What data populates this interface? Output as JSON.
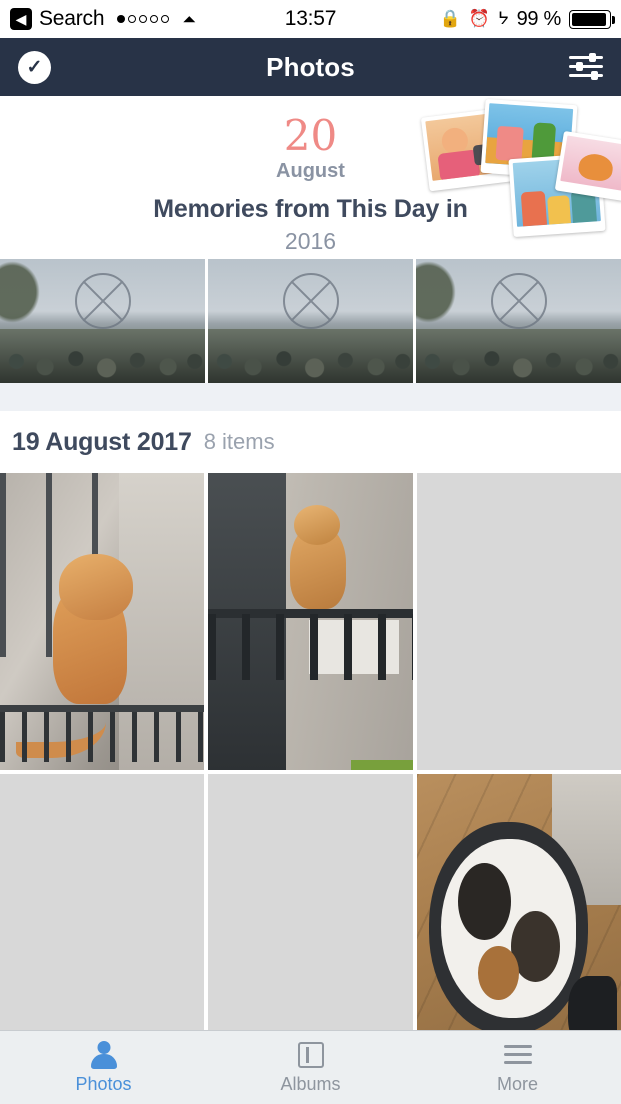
{
  "status_bar": {
    "back_label": "Search",
    "back_icon": "chevron-left-icon",
    "signal_icon": "signal-dots-icon",
    "signal_filled": 1,
    "signal_total": 5,
    "wifi_icon": "wifi-icon",
    "time": "13:57",
    "rotation_lock_icon": "rotation-lock-icon",
    "alarm_icon": "alarm-clock-icon",
    "bluetooth_icon": "bluetooth-icon",
    "battery_percent": "99 %",
    "battery_icon": "battery-icon"
  },
  "navbar": {
    "title": "Photos",
    "select_icon": "checkmark-circle-icon",
    "filter_icon": "sliders-filter-icon"
  },
  "memories": {
    "day": "20",
    "month": "August",
    "title": "Memories from This Day in",
    "year": "2016",
    "collage_icon": "polaroid-collage-icon"
  },
  "memory_strip": {
    "items": [
      {
        "name": "memory-photo-1",
        "alt": "ferris-wheel-crowd-photo"
      },
      {
        "name": "memory-photo-2",
        "alt": "ferris-wheel-crowd-photo"
      },
      {
        "name": "memory-photo-3",
        "alt": "ferris-wheel-crowd-photo"
      }
    ]
  },
  "section": {
    "date": "19 August 2017",
    "count": "8 items"
  },
  "grid": {
    "rows": [
      [
        {
          "name": "photo-cell-ginger-cat-railing",
          "kind": "cat1"
        },
        {
          "name": "photo-cell-cat-balcony",
          "kind": "cat2"
        },
        {
          "name": "photo-cell-placeholder",
          "kind": "placeholder"
        }
      ],
      [
        {
          "name": "photo-cell-placeholder",
          "kind": "placeholder"
        },
        {
          "name": "photo-cell-placeholder",
          "kind": "placeholder"
        },
        {
          "name": "photo-cell-calico-cat-floor",
          "kind": "cat3"
        }
      ]
    ]
  },
  "tabbar": {
    "items": [
      {
        "label": "Photos",
        "icon": "person-icon",
        "active": true
      },
      {
        "label": "Albums",
        "icon": "albums-icon",
        "active": false
      },
      {
        "label": "More",
        "icon": "hamburger-icon",
        "active": false
      }
    ]
  },
  "colors": {
    "navbar_bg": "#283347",
    "accent_blue": "#4a90d9",
    "memory_day": "#ef8a86",
    "muted_text": "#8a93a3",
    "title_text": "#3f4a5e"
  }
}
